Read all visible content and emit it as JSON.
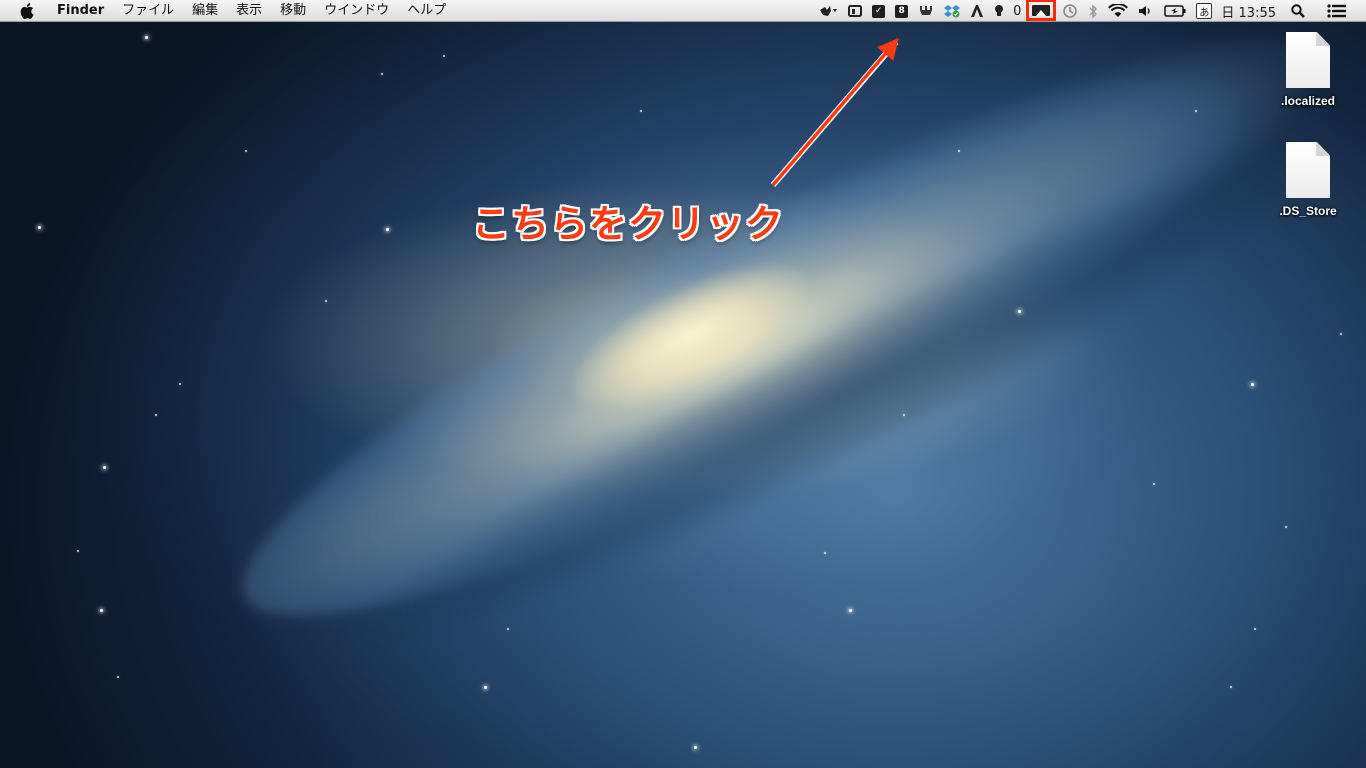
{
  "menubar": {
    "app_name": "Finder",
    "menus": [
      "ファイル",
      "編集",
      "表示",
      "移動",
      "ウインドウ",
      "ヘルプ"
    ],
    "status_icons": [
      "hand-cursor-icon",
      "cast-icon",
      "checkmark-icon",
      "evernote-icon",
      "plug-icon",
      "dropbox-icon",
      "font-icon",
      "lightbulb-icon",
      "airplay-icon",
      "time-machine-icon",
      "bluetooth-icon",
      "wifi-icon",
      "volume-icon",
      "battery-icon",
      "input-method-icon"
    ],
    "badge_count": "0",
    "input_method": "あ",
    "clock": "日 13:55",
    "highlight_color": "#ff2a00"
  },
  "annotation": {
    "text": "こちらをクリック",
    "color": "#ff3b14"
  },
  "desktop": {
    "icons": [
      {
        "label": ".localized"
      },
      {
        "label": ".DS_Store"
      }
    ]
  }
}
